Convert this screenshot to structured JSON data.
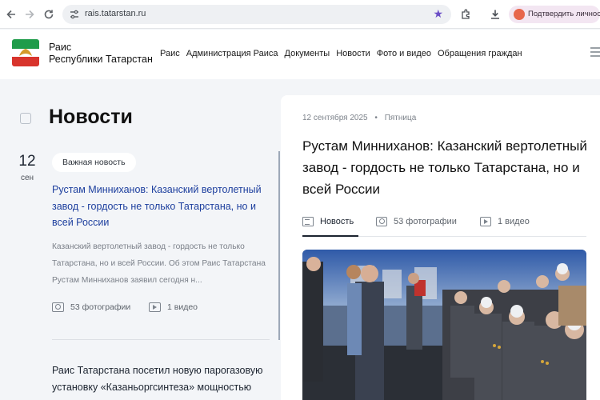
{
  "browser": {
    "url": "rais.tatarstan.ru",
    "verify_label": "Подтвердить личность",
    "icons": [
      "back-icon",
      "forward-icon",
      "reload-icon",
      "site-settings-icon",
      "bookmark-star-icon",
      "extensions-icon",
      "downloads-icon"
    ]
  },
  "colors": {
    "accent": "#1d3f9e",
    "brand_purple": "#6b4ec6",
    "flag_green": "#1f9c4a",
    "flag_red": "#d8342c"
  },
  "site": {
    "brand_line1": "Раис",
    "brand_line2": "Республики Татарстан",
    "nav": [
      "Раис",
      "Администрация Раиса",
      "Документы",
      "Новости",
      "Фото и видео",
      "Обращения граждан"
    ]
  },
  "page": {
    "title": "Новости"
  },
  "feed": {
    "items": [
      {
        "day": "12",
        "month": "сен",
        "badge": "Важная новость",
        "title": "Рустам Минниханов: Казанский вертолетный завод - гордость не только Татарстана, но и всей России",
        "excerpt": "Казанский вертолетный завод - гордость не только Татарстана, но и всей России. Об этом Раис Татарстана Рустам Минниханов заявил сегодня н...",
        "photos": "53 фотографии",
        "videos": "1 видео"
      },
      {
        "title": "Раис Татарстана посетил новую парогазовую установку «Казаньоргсинтеза» мощностью"
      }
    ]
  },
  "article": {
    "date": "12 сентября 2025",
    "weekday": "Пятница",
    "title": "Рустам Минниханов: Казанский вертолетный завод - гордость не только Татарстана, но и всей России",
    "tabs": [
      {
        "label": "Новость",
        "icon": "document-icon",
        "active": true
      },
      {
        "label": "53 фотографии",
        "icon": "camera-icon",
        "active": false
      },
      {
        "label": "1 видео",
        "icon": "video-icon",
        "active": false
      }
    ]
  }
}
